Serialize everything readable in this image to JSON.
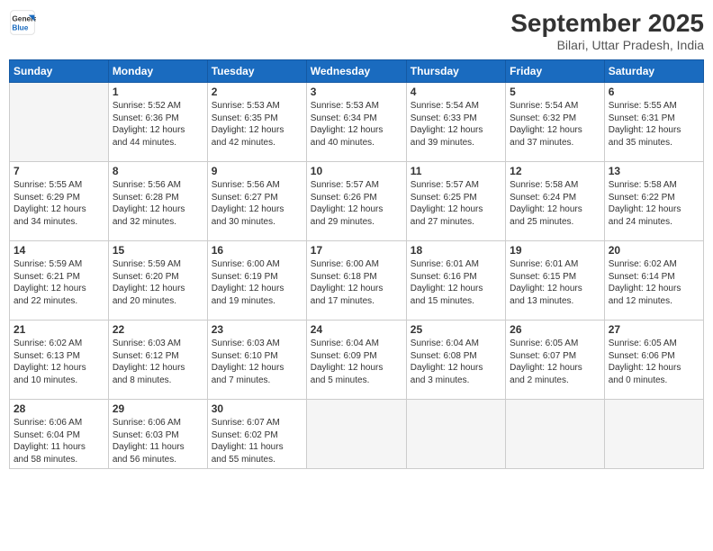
{
  "logo": {
    "line1": "General",
    "line2": "Blue"
  },
  "title": "September 2025",
  "subtitle": "Bilari, Uttar Pradesh, India",
  "days_header": [
    "Sunday",
    "Monday",
    "Tuesday",
    "Wednesday",
    "Thursday",
    "Friday",
    "Saturday"
  ],
  "weeks": [
    [
      {
        "num": "",
        "info": ""
      },
      {
        "num": "1",
        "info": "Sunrise: 5:52 AM\nSunset: 6:36 PM\nDaylight: 12 hours\nand 44 minutes."
      },
      {
        "num": "2",
        "info": "Sunrise: 5:53 AM\nSunset: 6:35 PM\nDaylight: 12 hours\nand 42 minutes."
      },
      {
        "num": "3",
        "info": "Sunrise: 5:53 AM\nSunset: 6:34 PM\nDaylight: 12 hours\nand 40 minutes."
      },
      {
        "num": "4",
        "info": "Sunrise: 5:54 AM\nSunset: 6:33 PM\nDaylight: 12 hours\nand 39 minutes."
      },
      {
        "num": "5",
        "info": "Sunrise: 5:54 AM\nSunset: 6:32 PM\nDaylight: 12 hours\nand 37 minutes."
      },
      {
        "num": "6",
        "info": "Sunrise: 5:55 AM\nSunset: 6:31 PM\nDaylight: 12 hours\nand 35 minutes."
      }
    ],
    [
      {
        "num": "7",
        "info": "Sunrise: 5:55 AM\nSunset: 6:29 PM\nDaylight: 12 hours\nand 34 minutes."
      },
      {
        "num": "8",
        "info": "Sunrise: 5:56 AM\nSunset: 6:28 PM\nDaylight: 12 hours\nand 32 minutes."
      },
      {
        "num": "9",
        "info": "Sunrise: 5:56 AM\nSunset: 6:27 PM\nDaylight: 12 hours\nand 30 minutes."
      },
      {
        "num": "10",
        "info": "Sunrise: 5:57 AM\nSunset: 6:26 PM\nDaylight: 12 hours\nand 29 minutes."
      },
      {
        "num": "11",
        "info": "Sunrise: 5:57 AM\nSunset: 6:25 PM\nDaylight: 12 hours\nand 27 minutes."
      },
      {
        "num": "12",
        "info": "Sunrise: 5:58 AM\nSunset: 6:24 PM\nDaylight: 12 hours\nand 25 minutes."
      },
      {
        "num": "13",
        "info": "Sunrise: 5:58 AM\nSunset: 6:22 PM\nDaylight: 12 hours\nand 24 minutes."
      }
    ],
    [
      {
        "num": "14",
        "info": "Sunrise: 5:59 AM\nSunset: 6:21 PM\nDaylight: 12 hours\nand 22 minutes."
      },
      {
        "num": "15",
        "info": "Sunrise: 5:59 AM\nSunset: 6:20 PM\nDaylight: 12 hours\nand 20 minutes."
      },
      {
        "num": "16",
        "info": "Sunrise: 6:00 AM\nSunset: 6:19 PM\nDaylight: 12 hours\nand 19 minutes."
      },
      {
        "num": "17",
        "info": "Sunrise: 6:00 AM\nSunset: 6:18 PM\nDaylight: 12 hours\nand 17 minutes."
      },
      {
        "num": "18",
        "info": "Sunrise: 6:01 AM\nSunset: 6:16 PM\nDaylight: 12 hours\nand 15 minutes."
      },
      {
        "num": "19",
        "info": "Sunrise: 6:01 AM\nSunset: 6:15 PM\nDaylight: 12 hours\nand 13 minutes."
      },
      {
        "num": "20",
        "info": "Sunrise: 6:02 AM\nSunset: 6:14 PM\nDaylight: 12 hours\nand 12 minutes."
      }
    ],
    [
      {
        "num": "21",
        "info": "Sunrise: 6:02 AM\nSunset: 6:13 PM\nDaylight: 12 hours\nand 10 minutes."
      },
      {
        "num": "22",
        "info": "Sunrise: 6:03 AM\nSunset: 6:12 PM\nDaylight: 12 hours\nand 8 minutes."
      },
      {
        "num": "23",
        "info": "Sunrise: 6:03 AM\nSunset: 6:10 PM\nDaylight: 12 hours\nand 7 minutes."
      },
      {
        "num": "24",
        "info": "Sunrise: 6:04 AM\nSunset: 6:09 PM\nDaylight: 12 hours\nand 5 minutes."
      },
      {
        "num": "25",
        "info": "Sunrise: 6:04 AM\nSunset: 6:08 PM\nDaylight: 12 hours\nand 3 minutes."
      },
      {
        "num": "26",
        "info": "Sunrise: 6:05 AM\nSunset: 6:07 PM\nDaylight: 12 hours\nand 2 minutes."
      },
      {
        "num": "27",
        "info": "Sunrise: 6:05 AM\nSunset: 6:06 PM\nDaylight: 12 hours\nand 0 minutes."
      }
    ],
    [
      {
        "num": "28",
        "info": "Sunrise: 6:06 AM\nSunset: 6:04 PM\nDaylight: 11 hours\nand 58 minutes."
      },
      {
        "num": "29",
        "info": "Sunrise: 6:06 AM\nSunset: 6:03 PM\nDaylight: 11 hours\nand 56 minutes."
      },
      {
        "num": "30",
        "info": "Sunrise: 6:07 AM\nSunset: 6:02 PM\nDaylight: 11 hours\nand 55 minutes."
      },
      {
        "num": "",
        "info": ""
      },
      {
        "num": "",
        "info": ""
      },
      {
        "num": "",
        "info": ""
      },
      {
        "num": "",
        "info": ""
      }
    ]
  ]
}
